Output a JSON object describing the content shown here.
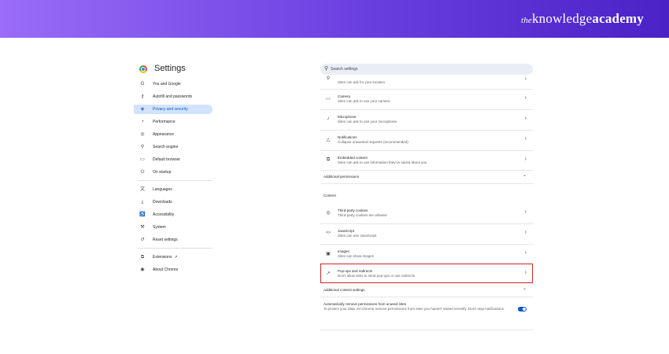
{
  "brand": {
    "prefix": "the",
    "word1": "knowledge",
    "word2": "academy"
  },
  "window": {
    "title": "Settings",
    "search_placeholder": "Search settings"
  },
  "icons": {
    "search": "search-icon",
    "chevron": "chevron-right-icon",
    "expand": "chevron-down-icon"
  },
  "sidebar": {
    "items": [
      {
        "label": "You and Google",
        "icon": "google-icon",
        "glyph": "G"
      },
      {
        "label": "Autofill and passwords",
        "icon": "key-icon",
        "glyph": "⚷"
      },
      {
        "label": "Privacy and security",
        "icon": "shield-icon",
        "glyph": "◈",
        "active": true
      },
      {
        "label": "Performance",
        "icon": "speedometer-icon",
        "glyph": "◔"
      },
      {
        "label": "Appearance",
        "icon": "palette-icon",
        "glyph": "◎"
      },
      {
        "label": "Search engine",
        "icon": "search-icon",
        "glyph": "⚲"
      },
      {
        "label": "Default browser",
        "icon": "browser-icon",
        "glyph": "▭"
      },
      {
        "label": "On startup",
        "icon": "power-icon",
        "glyph": "⏻"
      },
      {
        "label": "Languages",
        "icon": "translate-icon",
        "glyph": "文"
      },
      {
        "label": "Downloads",
        "icon": "download-icon",
        "glyph": "⤓"
      },
      {
        "label": "Accessibility",
        "icon": "accessibility-icon",
        "glyph": "♿"
      },
      {
        "label": "System",
        "icon": "wrench-icon",
        "glyph": "⚒"
      },
      {
        "label": "Reset settings",
        "icon": "reset-icon",
        "glyph": "↺"
      },
      {
        "label": "Extensions",
        "icon": "puzzle-icon",
        "glyph": "⧉",
        "external": "↗"
      },
      {
        "label": "About Chrome",
        "icon": "chrome-icon",
        "glyph": "◉"
      }
    ]
  },
  "permissions": [
    {
      "title": "",
      "subtitle": "Sites can ask for your location",
      "icon": "location-icon",
      "glyph": "⚲"
    },
    {
      "title": "Camera",
      "subtitle": "Sites can ask to use your camera",
      "icon": "camera-icon",
      "glyph": "▭"
    },
    {
      "title": "Microphone",
      "subtitle": "Sites can ask to use your microphone",
      "icon": "microphone-icon",
      "glyph": "♪"
    },
    {
      "title": "Notifications",
      "subtitle": "Collapse unwanted requests (recommended)",
      "icon": "bell-icon",
      "glyph": "△"
    },
    {
      "title": "Embedded content",
      "subtitle": "Sites can ask to use information they've saved about you",
      "icon": "embedded-icon",
      "glyph": "⧉"
    }
  ],
  "additional_permissions_label": "Additional permissions",
  "content_label": "Content",
  "content_items": [
    {
      "title": "Third-party cookies",
      "subtitle": "Third-party cookies are allowed",
      "icon": "cookie-icon",
      "glyph": "◎"
    },
    {
      "title": "JavaScript",
      "subtitle": "Sites can use JavaScript",
      "icon": "code-icon",
      "glyph": "<>"
    },
    {
      "title": "Images",
      "subtitle": "Sites can show images",
      "icon": "image-icon",
      "glyph": "▣"
    },
    {
      "title": "Pop-ups and redirects",
      "subtitle": "Don't allow sites to send pop-ups or use redirects",
      "icon": "popup-icon",
      "glyph": "↗",
      "highlighted": true
    }
  ],
  "additional_content_label": "Additional content settings",
  "auto_remove": {
    "title": "Automatically remove permissions from unused sites",
    "description": "To protect your data, let Chrome remove permissions from sites you haven't visited recently. Don't stop notifications.",
    "enabled": true
  },
  "colors": {
    "accent": "#0b57d0",
    "active_bg": "#d3e3fd",
    "highlight_border": "#c62828",
    "banner_start": "#9a6cf8",
    "banner_end": "#4a22c6"
  }
}
